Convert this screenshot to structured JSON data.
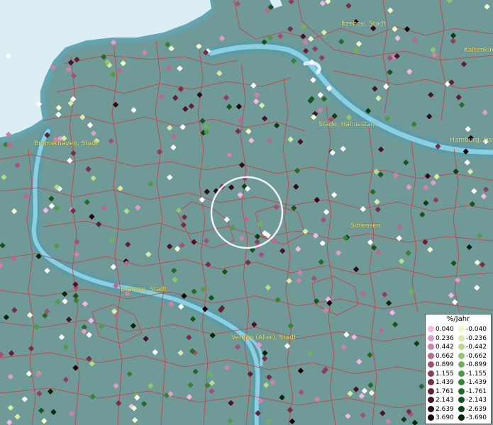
{
  "cities": [
    {
      "name": "Itzehoe, Stadt"
    },
    {
      "name": "Kaltenkirchen"
    },
    {
      "name": "Bremerhaven, Stadt"
    },
    {
      "name": "Stade, Hansestadt"
    },
    {
      "name": "Hamburg, Freie und Hansestadt"
    },
    {
      "name": "Sittensen"
    },
    {
      "name": "Bremen, Stadt"
    },
    {
      "name": "Verden (Aller), Stadt"
    }
  ],
  "legend": {
    "title": "%/Jahr",
    "positive": [
      {
        "value": "0.040",
        "color": "#f3b8e4"
      },
      {
        "value": "0.236",
        "color": "#e59bc9"
      },
      {
        "value": "0.442",
        "color": "#d57fab"
      },
      {
        "value": "0.662",
        "color": "#c06490"
      },
      {
        "value": "0.899",
        "color": "#a84e76"
      },
      {
        "value": "1.155",
        "color": "#923d5e"
      },
      {
        "value": "1.439",
        "color": "#7a2d48"
      },
      {
        "value": "1.761",
        "color": "#631f34"
      },
      {
        "value": "2.143",
        "color": "#4a1223"
      },
      {
        "value": "2.639",
        "color": "#330915"
      },
      {
        "value": "3.690",
        "color": "#1c030a"
      }
    ],
    "negative": [
      {
        "value": "-0.040",
        "color": "#f3f8c8"
      },
      {
        "value": "-0.236",
        "color": "#d7eda7"
      },
      {
        "value": "-0.442",
        "color": "#b5dc88"
      },
      {
        "value": "-0.662",
        "color": "#8ec86c"
      },
      {
        "value": "-0.899",
        "color": "#6cb458"
      },
      {
        "value": "-1.155",
        "color": "#4e9c45"
      },
      {
        "value": "-1.439",
        "color": "#358434"
      },
      {
        "value": "-1.761",
        "color": "#236c26"
      },
      {
        "value": "-2.143",
        "color": "#16561b"
      },
      {
        "value": "-2.639",
        "color": "#0c4012"
      },
      {
        "value": "-3.690",
        "color": "#042808"
      }
    ]
  },
  "colors": {
    "land": "#6f9a98",
    "sea": "#dceef4",
    "river": "#7fc2d6",
    "borders": "#d8353a",
    "city_label": "#f0e060",
    "selection_circle": "#ffffff"
  }
}
